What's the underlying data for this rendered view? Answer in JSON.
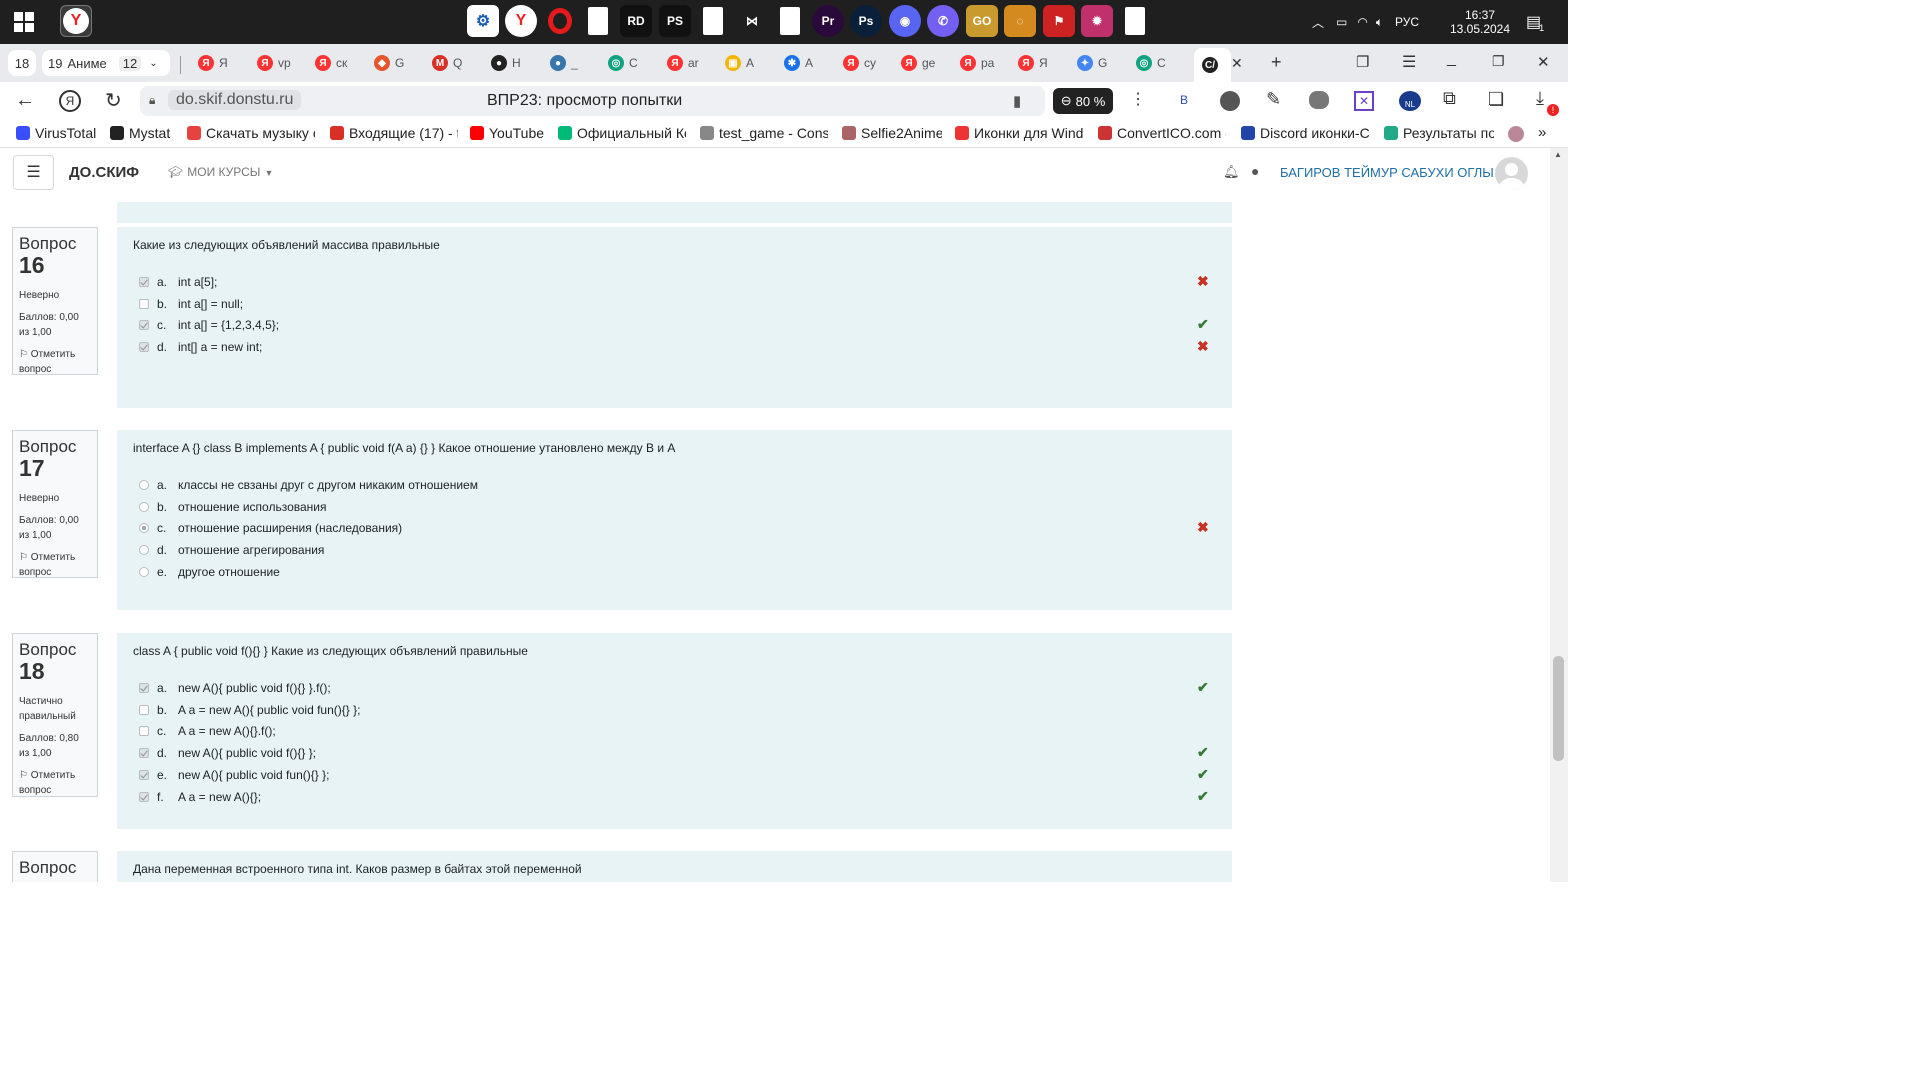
{
  "taskbar": {
    "apps": [
      "yandex-browser",
      "opera",
      "file",
      "rider",
      "phpstorm",
      "file",
      "visual-studio",
      "file",
      "premiere-pro",
      "photoshop",
      "discord",
      "viber",
      "csgo",
      "naruto",
      "forza",
      "game",
      "file"
    ],
    "lang": "РУС",
    "time": "16:37",
    "date": "13.05.2024",
    "notif_count": "1"
  },
  "tabs": {
    "group1": "18",
    "group2_count": "19",
    "group2_label": "Аниме",
    "group3": "12",
    "items": [
      {
        "icon": "Я",
        "label": "Я",
        "color": "#f33"
      },
      {
        "icon": "Я",
        "label": "vp",
        "color": "#f33"
      },
      {
        "icon": "Я",
        "label": "ск",
        "color": "#f33"
      },
      {
        "icon": "◆",
        "label": "G",
        "color": "#e8542c"
      },
      {
        "icon": "M",
        "label": "Q",
        "color": "#d93025"
      },
      {
        "icon": "●",
        "label": "H",
        "color": "#222"
      },
      {
        "icon": "●",
        "label": "_",
        "color": "#3776ab"
      },
      {
        "icon": "◎",
        "label": "C",
        "color": "#10a37f"
      },
      {
        "icon": "Я",
        "label": "ar",
        "color": "#f33"
      },
      {
        "icon": "▣",
        "label": "A",
        "color": "#f5b400"
      },
      {
        "icon": "✱",
        "label": "A",
        "color": "#1a73e8"
      },
      {
        "icon": "Я",
        "label": "су",
        "color": "#f33"
      },
      {
        "icon": "Я",
        "label": "ge",
        "color": "#f33"
      },
      {
        "icon": "Я",
        "label": "pa",
        "color": "#f33"
      },
      {
        "icon": "Я",
        "label": "Я",
        "color": "#f33"
      },
      {
        "icon": "✦",
        "label": "G",
        "color": "#4285f4"
      },
      {
        "icon": "◎",
        "label": "C",
        "color": "#10a37f"
      },
      {
        "icon": "С/",
        "label": "",
        "color": "#222"
      }
    ]
  },
  "nav": {
    "url": "do.skif.donstu.ru",
    "page_title": "ВПР23: просмотр попытки",
    "zoom": "80 %",
    "ext_label": "B"
  },
  "bookmarks": [
    {
      "label": "VirusTotal",
      "color": "#394eff"
    },
    {
      "label": "Mystat",
      "color": "#222"
    },
    {
      "label": "Скачать музыку с",
      "color": "#e8423f"
    },
    {
      "label": "Входящие (17) - t",
      "color": "#d93025"
    },
    {
      "label": "YouTube",
      "color": "#ff0000"
    },
    {
      "label": "Официальный Ко",
      "color": "#0b7"
    },
    {
      "label": "test_game - Const",
      "color": "#888"
    },
    {
      "label": "Selfie2Anime",
      "color": "#a66"
    },
    {
      "label": "Иконки для Wind",
      "color": "#e33"
    },
    {
      "label": "ConvertICO.com -",
      "color": "#c33"
    },
    {
      "label": "Discord иконки-С",
      "color": "#2245aa"
    },
    {
      "label": "Результаты по",
      "color": "#2a8"
    }
  ],
  "site": {
    "brand": "ДО.СКИФ",
    "menu": "МОИ КУРСЫ",
    "user": "БАГИРОВ ТЕЙМУР САБУХИ ОГЛЫ"
  },
  "questions": [
    {
      "word": "Вопрос",
      "num": "16",
      "status": "Неверно",
      "grade": "Баллов: 0,00 из 1,00",
      "flag": "Отметить вопрос",
      "text": "Какие из следующих объявлений массива правильные",
      "type": "checkbox",
      "answers": [
        {
          "letter": "a.",
          "text": "int a[5];",
          "checked": true,
          "mark": "x"
        },
        {
          "letter": "b.",
          "text": "int a[] = null;",
          "checked": false,
          "mark": ""
        },
        {
          "letter": "c.",
          "text": "int a[] = {1,2,3,4,5};",
          "checked": true,
          "mark": "ok"
        },
        {
          "letter": "d.",
          "text": "int[] a = new int;",
          "checked": true,
          "mark": "x"
        }
      ]
    },
    {
      "word": "Вопрос",
      "num": "17",
      "status": "Неверно",
      "grade": "Баллов: 0,00 из 1,00",
      "flag": "Отметить вопрос",
      "text": "interface A {} class B implements A { public void f(A a) {} } Какое отношение утановлено между B и A",
      "type": "radio",
      "answers": [
        {
          "letter": "a.",
          "text": "классы не свзаны друг с другом никаким отношением",
          "checked": false,
          "mark": ""
        },
        {
          "letter": "b.",
          "text": "отношение использования",
          "checked": false,
          "mark": ""
        },
        {
          "letter": "c.",
          "text": "отношение расширения (наследования)",
          "checked": true,
          "mark": "x"
        },
        {
          "letter": "d.",
          "text": "отношение агрегирования",
          "checked": false,
          "mark": ""
        },
        {
          "letter": "e.",
          "text": "другое отношение",
          "checked": false,
          "mark": ""
        }
      ]
    },
    {
      "word": "Вопрос",
      "num": "18",
      "status": "Частично правильный",
      "grade": "Баллов: 0,80 из 1,00",
      "flag": "Отметить вопрос",
      "text": "class A { public void f(){} } Какие из следующих объявлений правильные",
      "type": "checkbox",
      "answers": [
        {
          "letter": "a.",
          "text": "new A(){ public void f(){} }.f();",
          "checked": true,
          "mark": "ok"
        },
        {
          "letter": "b.",
          "text": "A a = new A(){ public void fun(){} };",
          "checked": false,
          "mark": ""
        },
        {
          "letter": "c.",
          "text": "A a = new A(){}.f();",
          "checked": false,
          "mark": ""
        },
        {
          "letter": "d.",
          "text": "new A(){ public void f(){} };",
          "checked": true,
          "mark": "ok"
        },
        {
          "letter": "e.",
          "text": "new A(){ public void fun(){} };",
          "checked": true,
          "mark": "ok"
        },
        {
          "letter": "f.",
          "text": "A a = new A(){};",
          "checked": true,
          "mark": "ok"
        }
      ]
    },
    {
      "word": "Вопрос",
      "text": "Дана переменная встроенного типа int. Каков размер в байтах этой переменной"
    }
  ]
}
